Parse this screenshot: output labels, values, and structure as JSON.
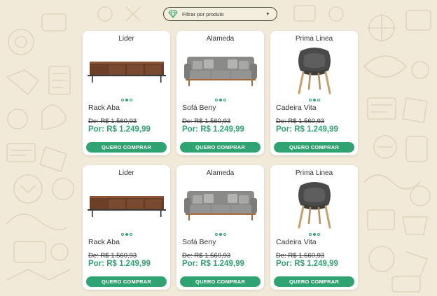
{
  "filter": {
    "label": "Filtrar por produto",
    "icon": "diamond-filter-icon",
    "chevron": "▾"
  },
  "colors": {
    "accent": "#2fa371",
    "background": "#f1ead8",
    "card": "#ffffff"
  },
  "products": [
    {
      "brand": "Lider",
      "name": "Rack Aba",
      "old_price": "De: R$ 1.560,93",
      "new_price": "Por: R$ 1.249,99",
      "button": "QUERO COMPRAR",
      "image": "rack-image",
      "active_dot": 1
    },
    {
      "brand": "Alameda",
      "name": "Sofá Beny",
      "old_price": "De: R$ 1.560,93",
      "new_price": "Por: R$ 1.249,99",
      "button": "QUERO COMPRAR",
      "image": "sofa-image",
      "active_dot": 1
    },
    {
      "brand": "Prima Linea",
      "name": "Cadeira Vita",
      "old_price": "De: R$ 1.560,93",
      "new_price": "Por: R$ 1.249,99",
      "button": "QUERO COMPRAR",
      "image": "chair-image",
      "active_dot": 1
    },
    {
      "brand": "Lider",
      "name": "Rack Aba",
      "old_price": "De: R$ 1.560,93",
      "new_price": "Por: R$ 1.249,99",
      "button": "QUERO COMPRAR",
      "image": "rack-image",
      "active_dot": 1
    },
    {
      "brand": "Alameda",
      "name": "Sofá Beny",
      "old_price": "De: R$ 1.560,93",
      "new_price": "Por: R$ 1.249,99",
      "button": "QUERO COMPRAR",
      "image": "sofa-image",
      "active_dot": 1
    },
    {
      "brand": "Prima Linea",
      "name": "Cadeira Vita",
      "old_price": "De: R$ 1.560,93",
      "new_price": "Por: R$ 1.249,99",
      "button": "QUERO COMPRAR",
      "image": "chair-image",
      "active_dot": 1
    }
  ]
}
